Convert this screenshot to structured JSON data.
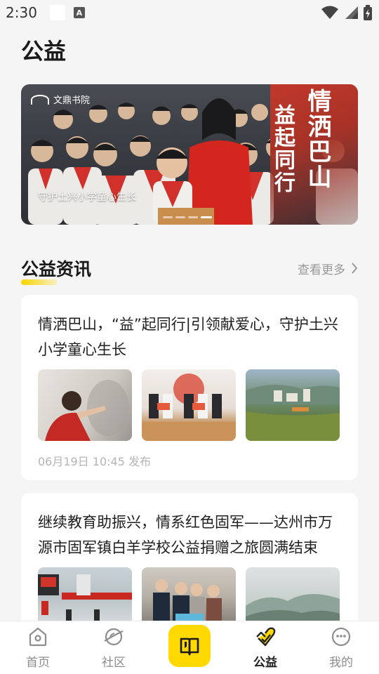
{
  "status_bar": {
    "time": "2:30",
    "notification_icon": "a-icon"
  },
  "page": {
    "title": "公益"
  },
  "banner": {
    "logo_text": "文鼎书院",
    "calligraphy_line1": "情洒巴山",
    "calligraphy_line2": "益起同行",
    "caption": "守护土兴小学童心生长",
    "slide_count": 4,
    "active_slide": 4
  },
  "news_section": {
    "title": "公益资讯",
    "more_label": "查看更多",
    "accent_color": "#ffd400"
  },
  "articles": [
    {
      "title": "情洒巴山，“益”起同行|引领献爱心，守护土兴小学童心生长",
      "meta": "06月19日 10:45 发布"
    },
    {
      "title": "继续教育助振兴，情系红色固军——达州市万源市固军镇白羊学校公益捐赠之旅圆满结束",
      "meta": ""
    }
  ],
  "tabbar": {
    "items": [
      {
        "label": "首页",
        "icon": "home-icon"
      },
      {
        "label": "社区",
        "icon": "planet-icon"
      },
      {
        "label": "",
        "icon": "book-icon"
      },
      {
        "label": "公益",
        "icon": "heart-check-icon"
      },
      {
        "label": "我的",
        "icon": "smile-icon"
      }
    ],
    "active": "公益",
    "center_color": "#ffd900"
  }
}
